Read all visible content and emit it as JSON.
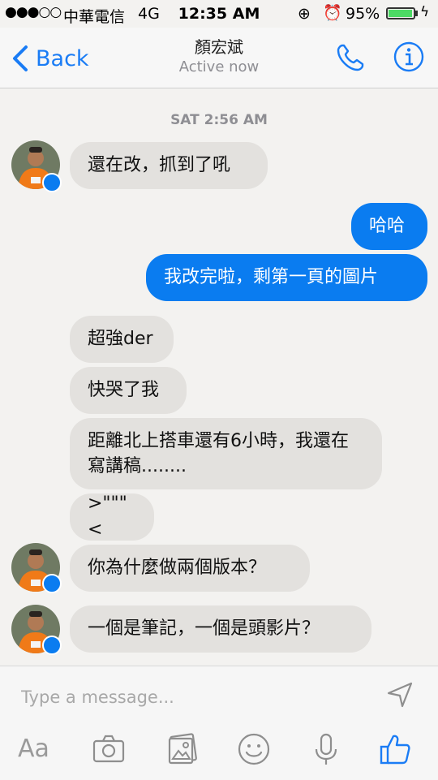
{
  "status_bar": {
    "signal": "●●●○○",
    "carrier": "中華電信",
    "network": "4G",
    "time": "12:35 AM",
    "battery": "95%",
    "battery_level": 0.95
  },
  "header": {
    "back_label": "Back",
    "contact_name": "顏宏斌",
    "contact_status": "Active now"
  },
  "conversation": {
    "timestamp": "SAT 2:56 AM",
    "messages": [
      {
        "from": "contact",
        "text": "還在改，抓到了吼"
      },
      {
        "from": "me",
        "text": "哈哈"
      },
      {
        "from": "me",
        "text": "我改完啦，剩第一頁的圖片"
      },
      {
        "from": "contact",
        "text": "超強der"
      },
      {
        "from": "contact",
        "text": "快哭了我"
      },
      {
        "from": "contact",
        "text": "距離北上搭車還有6小時，我還在寫講稿........"
      },
      {
        "from": "contact",
        "text": ">\"\"\"<"
      },
      {
        "from": "contact",
        "text": "你為什麼做兩個版本？"
      },
      {
        "from": "contact",
        "text": "一個是筆記，一個是頭影片？"
      }
    ]
  },
  "composer": {
    "placeholder": "Type a message...",
    "font_button": "Aa"
  },
  "colors": {
    "accent": "#1a7cf5",
    "outgoing_bubble": "#0a7cf0",
    "incoming_bubble": "#e3e1de",
    "background": "#f3f2f0"
  }
}
